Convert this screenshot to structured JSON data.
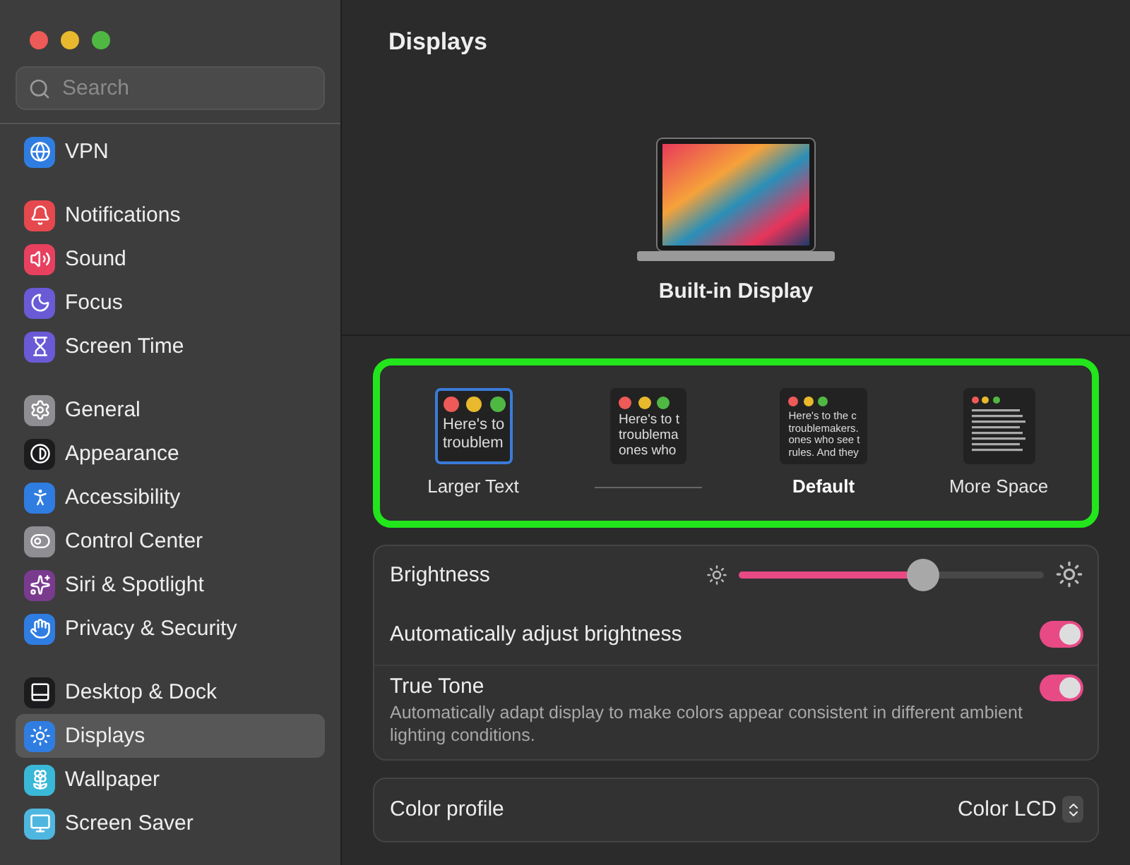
{
  "window": {
    "title": "Displays"
  },
  "search": {
    "placeholder": "Search"
  },
  "sidebar": {
    "groups": [
      [
        {
          "label": "VPN",
          "color": "#2f7de1",
          "selected": false
        }
      ],
      [
        {
          "label": "Notifications",
          "color": "#e5484d",
          "selected": false
        },
        {
          "label": "Sound",
          "color": "#e8415f",
          "selected": false
        },
        {
          "label": "Focus",
          "color": "#6a5ad6",
          "selected": false
        },
        {
          "label": "Screen Time",
          "color": "#6a5ad6",
          "selected": false
        }
      ],
      [
        {
          "label": "General",
          "color": "#8e8e93",
          "selected": false
        },
        {
          "label": "Appearance",
          "color": "#1c1c1e",
          "selected": false
        },
        {
          "label": "Accessibility",
          "color": "#2f7de1",
          "selected": false
        },
        {
          "label": "Control Center",
          "color": "#8e8e93",
          "selected": false
        },
        {
          "label": "Siri & Spotlight",
          "color": "#7a3b8f",
          "selected": false
        },
        {
          "label": "Privacy & Security",
          "color": "#2f7de1",
          "selected": false
        }
      ],
      [
        {
          "label": "Desktop & Dock",
          "color": "#1c1c1e",
          "selected": false
        },
        {
          "label": "Displays",
          "color": "#2f7de1",
          "selected": true
        },
        {
          "label": "Wallpaper",
          "color": "#3ab8d8",
          "selected": false
        },
        {
          "label": "Screen Saver",
          "color": "#4fb6e0",
          "selected": false
        }
      ]
    ]
  },
  "display": {
    "name": "Built-in Display"
  },
  "resolutions": [
    {
      "kind": "preview",
      "label": "Larger Text",
      "selected": true,
      "default": false,
      "preview_lines": [
        "Here's to",
        "troublem"
      ]
    },
    {
      "kind": "preview",
      "selected": false,
      "default": false,
      "preview_lines": [
        "Here's to t",
        "troublema",
        "ones who"
      ]
    },
    {
      "kind": "preview",
      "label": "Default",
      "selected": false,
      "default": true,
      "preview_lines": [
        "Here's to the c",
        "troublemakers.",
        "ones who see t",
        "rules. And they"
      ]
    },
    {
      "kind": "lines",
      "label": "More Space",
      "selected": false,
      "default": false
    }
  ],
  "brightness": {
    "label": "Brightness",
    "level": 0.6
  },
  "toggles": [
    {
      "label": "Automatically adjust brightness",
      "on": true
    },
    {
      "label": "True Tone",
      "description": "Automatically adapt display to make colors appear consistent in different ambient lighting conditions.",
      "on": true
    }
  ],
  "color_profile": {
    "label": "Color profile",
    "value": "Color LCD"
  }
}
